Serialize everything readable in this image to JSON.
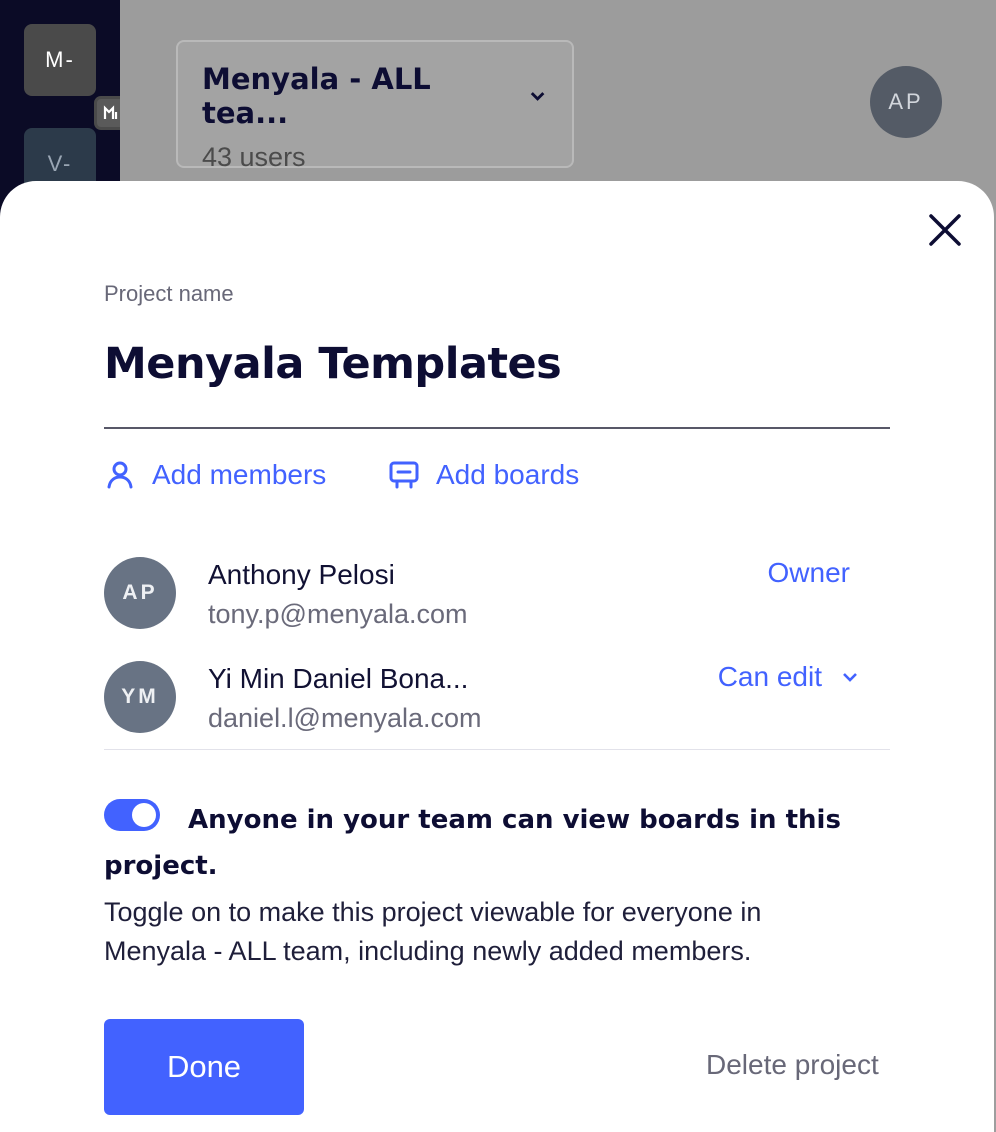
{
  "background": {
    "workspaces": [
      {
        "initials": "M-"
      },
      {
        "initials": "V-"
      }
    ],
    "team_selector": {
      "name": "Menyala - ALL tea...",
      "subtitle": "43 users"
    },
    "current_user_initials": "AP"
  },
  "modal": {
    "field_label": "Project name",
    "project_name": "Menyala Templates",
    "actions": {
      "add_members": "Add members",
      "add_boards": "Add boards"
    },
    "members": [
      {
        "initials": "AP",
        "name": "Anthony Pelosi",
        "email": "tony.p@menyala.com",
        "role": "Owner"
      },
      {
        "initials": "YM",
        "name": "Yi Min Daniel Bona...",
        "email": "daniel.l@menyala.com",
        "role": "Can edit"
      }
    ],
    "visibility": {
      "enabled": true,
      "title": "Anyone in your team can view boards in this project.",
      "description": "Toggle on to make this project viewable for everyone in Menyala - ALL team, including newly added members."
    },
    "done_label": "Done",
    "delete_label": "Delete project"
  },
  "colors": {
    "accent": "#4262ff",
    "heading": "#0d0d33",
    "muted": "#686878",
    "avatar": "#687384"
  }
}
